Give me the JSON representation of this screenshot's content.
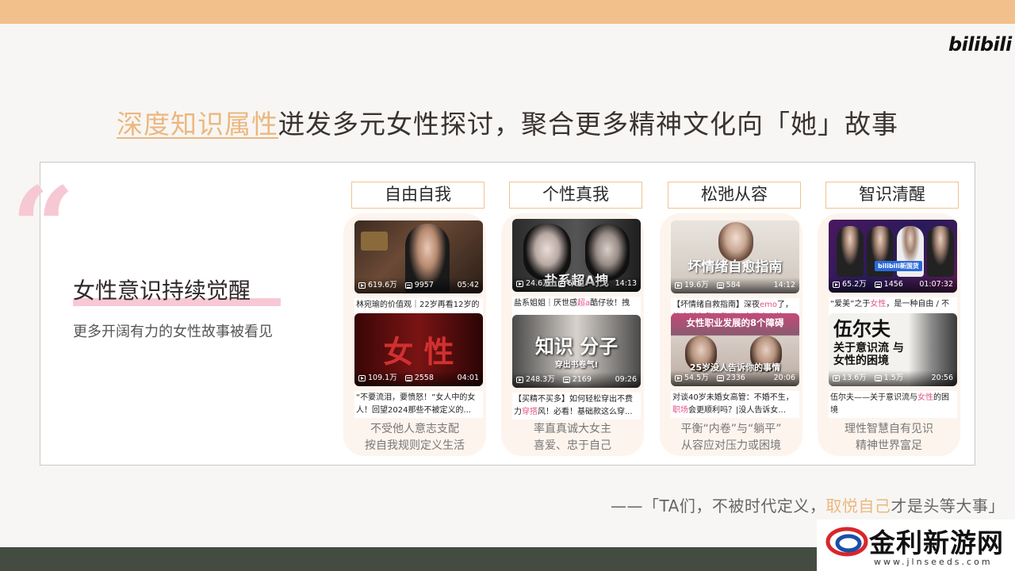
{
  "brand": "bilibili",
  "headline": {
    "accent": "深度知识属性",
    "rest": "迸发多元女性探讨，聚合更多精神文化向「她」故事"
  },
  "section": {
    "title": "女性意识持续觉醒",
    "subtitle": "更多开阔有力的女性故事被看见"
  },
  "columns": [
    {
      "label": "自由自我",
      "videos": [
        {
          "views": "619.6万",
          "danmaku": "9957",
          "duration": "05:42",
          "title": "林宛瑜的价值观｜22岁再看12岁的",
          "overlay": ""
        },
        {
          "views": "109.1万",
          "danmaku": "2558",
          "duration": "04:01",
          "title": "“不要流泪，要愤怒！”女人中的女人！回望2024那些不被定义的...",
          "overlay": "女  性"
        }
      ],
      "footer": [
        "不受他人意志支配",
        "按自我规则定义生活"
      ]
    },
    {
      "label": "个性真我",
      "videos": [
        {
          "views": "24.6万",
          "danmaku": "648",
          "duration": "14:13",
          "title_pre": "盐系姐姐｜厌世感",
          "title_pink": "超a",
          "title_post": "酷仔妆！拽",
          "overlay": "盐系超A拽"
        },
        {
          "views": "248.3万",
          "danmaku": "2169",
          "duration": "09:26",
          "title_pre": "【买精不买多】如何轻松穿出不费力",
          "title_pink": "穿搭",
          "title_post": "风！必看！基础款这么穿...",
          "overlay": "知识    分子",
          "overlay_sub": "穿出书卷气!"
        }
      ],
      "footer": [
        "率直真诚大女主",
        "喜爱、忠于自己"
      ]
    },
    {
      "label": "松弛从容",
      "videos": [
        {
          "views": "19.6万",
          "danmaku": "584",
          "duration": "14:12",
          "title_pre": "【坏情绪自救指南】深夜",
          "title_pink": "emo",
          "title_post": "了，就这样自我拯救吧！直面内心的...",
          "overlay": "坏情绪自愈指南"
        },
        {
          "views": "54.5万",
          "danmaku": "2336",
          "duration": "20:06",
          "title_pre": "对谈40岁未婚女高管：不婚不生，",
          "title_pink": "职场",
          "title_post": "会更顺利吗？|没人告诉女...",
          "overlay": "女性职业发展的8个障碍",
          "overlay_sub": "25岁没人告诉你的事情"
        }
      ],
      "footer": [
        "平衡“内卷”与“躺平”",
        "从容应对压力或困境"
      ]
    },
    {
      "label": "智识清醒",
      "videos": [
        {
          "views": "65.2万",
          "danmaku": "1456",
          "duration": "01:07:32",
          "title_pre": "“爱美”之于",
          "title_pink": "女性",
          "title_post": "，是一种自由 / 不",
          "overlay": "bilibili新国货"
        },
        {
          "views": "13.6万",
          "danmaku": "1.5万",
          "duration": "20:56",
          "title_pre": "伍尔夫——关于意识流与",
          "title_pink": "女性",
          "title_post": "的困境",
          "overlay": "伍尔夫",
          "overlay_sub": "关于意识流 与 女性的困境"
        }
      ],
      "footer": [
        "理性智慧自有见识",
        "精神世界富足"
      ]
    }
  ],
  "signature": {
    "pre": "——「TA们，不被时代定义，",
    "accent": "取悦自己",
    "post": "才是头等大事」"
  },
  "watermark": {
    "name": "金利新游网",
    "url": "www.jlnseeds.com"
  }
}
